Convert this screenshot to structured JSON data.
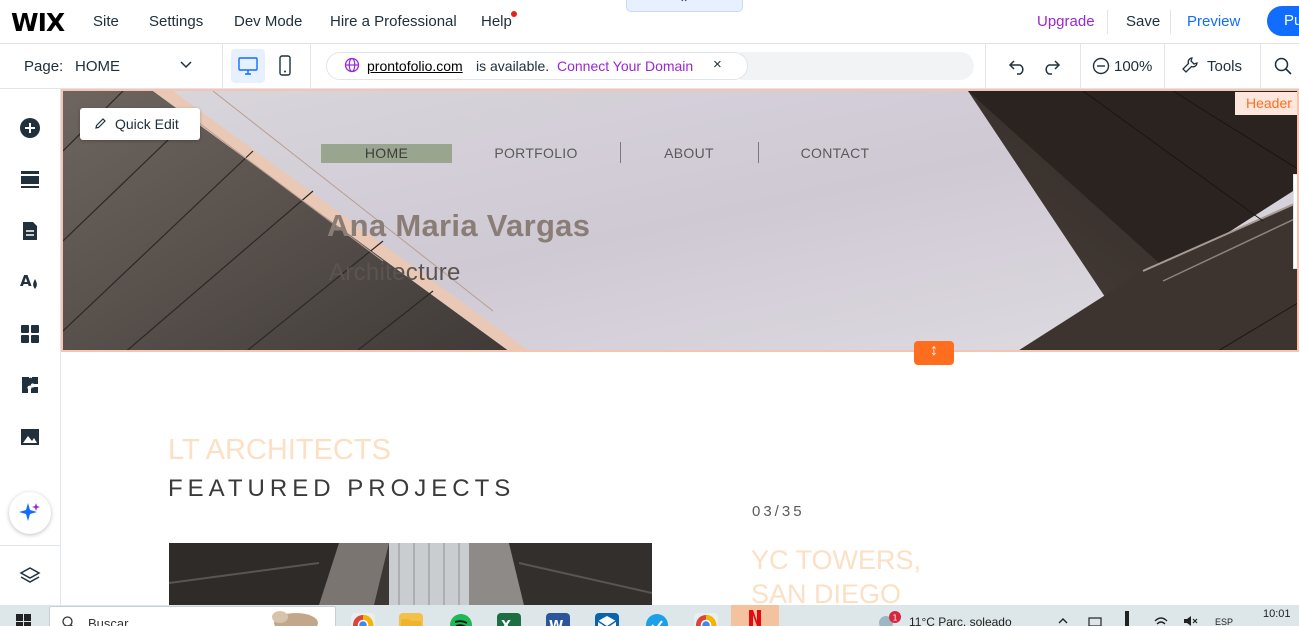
{
  "topbar": {
    "logo": "WIX",
    "menu": [
      "Site",
      "Settings",
      "Dev Mode",
      "Hire a Professional",
      "Help"
    ],
    "upgrade": "Upgrade",
    "save": "Save",
    "preview": "Preview",
    "publish": "Pu"
  },
  "pagebar": {
    "page_label": "Page:",
    "page_value": "HOME",
    "domain": "prontofolio.com",
    "available": "is available.",
    "connect": "Connect Your Domain",
    "close": "×",
    "zoom": "100%",
    "tools": "Tools"
  },
  "sidebar": {
    "icons": [
      "add-icon",
      "sections-icon",
      "pages-icon",
      "design-icon",
      "apps-icon",
      "business-apps-icon",
      "media-icon",
      "ai-assistant-icon",
      "layers-icon"
    ]
  },
  "canvas": {
    "header_tag": "Header",
    "quick_edit": "Quick Edit",
    "nav": [
      "HOME",
      "PORTFOLIO",
      "ABOUT",
      "CONTACT"
    ],
    "site_name": "Ana Maria Vargas",
    "tagline": "Architecture",
    "section_kicker": "LT ARCHITECTS",
    "section_title": "FEATURED PROJECTS",
    "counter": "03/35",
    "project_title_line1": "YC TOWERS,",
    "project_title_line2": "SAN DIEGO"
  },
  "taskbar": {
    "search_placeholder": "Buscar",
    "weather": "11°C  Parc. soleado",
    "lang": "ESP",
    "time": "10:01",
    "notification_count": "1"
  },
  "colors": {
    "accent": "#116dff",
    "upgrade": "#9a27d5",
    "header_outline": "#f6c4b0",
    "handle": "#ff6d1f",
    "kicker": "#fbe0c4"
  }
}
